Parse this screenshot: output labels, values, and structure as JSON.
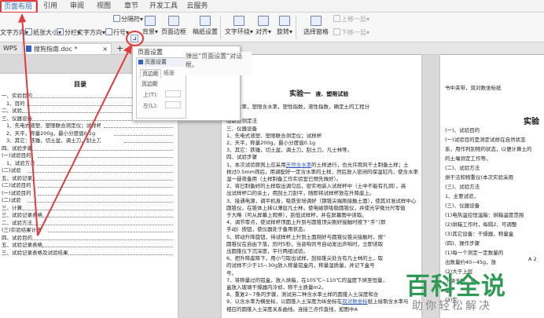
{
  "ribbon": {
    "tabs": [
      "页面布局",
      "引用",
      "审阅",
      "视图",
      "章节",
      "开发工具",
      "云服务"
    ],
    "active_tab": "页面布局"
  },
  "toolbar": {
    "row1": [
      "分隔符",
      "行号",
      "背景",
      "页面边框",
      "稿纸设置",
      "文字环绕",
      "对齐",
      "旋转",
      "选择窗格",
      "上移一层",
      "下移一层"
    ],
    "row2": [
      "文字方向",
      "纸张大小",
      "分栏",
      "文字方向",
      "分隔符"
    ]
  },
  "doc_tabs": {
    "left_label": "WPS",
    "active_doc": "搜狗指南.doc *",
    "add": "+"
  },
  "popup": {
    "title": "页面设置",
    "dialog_title": "页面设置",
    "tabs": [
      "页边距",
      "纸张"
    ],
    "section": "页边距",
    "top_label": "上(T):",
    "left_label": "左(L):",
    "tooltip": "弹出“页面设置”对话框。"
  },
  "page1": {
    "title": "目录",
    "toc": [
      "一、实验目的",
      "1、目的",
      "二、试验",
      "三、仪器设备",
      "1、先电式液塑、塑限联合测定仪；试样杯",
      "2、天平，称量200g，最小分度值0.1g",
      "3、其它：铁锤，切土盆，调土刀，刮土刀，凡士林等。",
      "四、试验步骤",
      "(一)试验目的",
      "1、试验方法",
      "(二)试验",
      "五、试验记录",
      "(二)试验目的",
      "(一)试验目的",
      "(二)试验",
      "三、计算",
      "三、试验记录表格",
      "二、试验方法",
      "(三)实验结果计算",
      "四、试验目的",
      "五、试验记录表格",
      "三、试验记录表格及试验结果"
    ]
  },
  "page2": {
    "heading": "实验一",
    "heading2": "液、塑限试验",
    "lines": [
      "限含水率，塑限含水率，塑性指数，液性指数，确定土的工程分",
      "",
      "限联合测定法",
      "三、仪器设备",
      "1、先电式液塑、塑限联合测定仪；试样杯",
      "2、天平，称量200g，最小分度值0.1g",
      "3、其它：铁锤，切土盆，调土刀，刮土刀，凡士林等。",
      "四、试验步骤",
      "1、本次试验原则上应采用天然含水率的土样进行，也允许用风干土制备土样；土",
      "样过0.5mm筛后，用调配好一定含水率的土样，然后放入密闭的保湿缸内，使含水率",
      "湿一昼夜备用（土样制备工作实验室已预先做好）。",
      "2、将已制备好的土样取出调匀后，密实地装入试样杯中（土中不能有孔洞），高",
      "出试样杯口的余土，用刮土刀刮平，随即将试样杯放在升降座上。",
      "3、接通电源，调平机身，吸铁安培调好（钢锥尖端刚接触土面），使其对准试样中心",
      "圆锥仪，在锥体上抹以薄层凡士林，使电磁铁吸稳圆锥仪，并使光学微分尺零值",
      "于大略（可从屏幕上观察），刮低试样杯，并在屏幕图中读取。",
      "4、调节零点，使试样杯顶面上升到与圆锥顶尖刚好接触时按下“手”（即",
      "手动）按钮，使仪器处于备用状态。",
      "5、转动升降旋钮，待试样杯上升到土面刚好与圆锥仪锥尖接触时，按“",
      "圆锥仪在自由下落，历时5秒，当音响讯号自动发出声响时，立即读取",
      "出圆锥仪下沉深度，平行两组试验。",
      "6、把升降座降下，用小勺取出试样，刮除锥尖处含有凡士林的土，取",
      "的试样不少于15~30g放入称量铝盒内，称量湿质量，并记下盒号",
      "号。",
      "7、将称量过的铝盒，放入烘箱，在105℃~110℃的温度下烘至恒量，",
      "盒放入玻璃干燥器内冷却，称干土质量m2。",
      "8、重复2~7条的步骤，测试另二种含水率土样的圆锥入土深度和含",
      "9、以含水率为横坐标，以圆锥入土深度为纵坐标在双对数坐标纸上绘制含水率与",
      "相应的圆锥入土深度关系曲线。连接三点作直线，如图中A"
    ]
  },
  "page3": {
    "header_line": "书中夹带，双对数坐标纸",
    "heading": "实验",
    "lines": [
      "(一)、试验目的",
      "(一)试验目的是测定试样在自然状态",
      "系，用作判别物的状态，以便计算土的",
      "的土壤测定工作等。",
      "(二)、试验方法",
      "烘干法和物重仪(本次实验采用",
      "(三)、试验方法",
      "1、主要试验，",
      "(三)、仪器设备",
      "(1)电热温控恒温箱：烘箱温度范围",
      "(2)烘箱工作时，每隔2、可调整",
      "(3)其它设备：干燥器，称量盒",
      "(四)、操作步骤",
      "(1)每一个测定一定数量的",
      "出数量约40~45g，放",
      "(2)大于上层",
      "下烘干时，对",
      "量。",
      "(3)实"
    ],
    "figure_label": "A 2"
  },
  "watermark": {
    "main": "百科全说",
    "sub": "助你轻松解决"
  },
  "colors": {
    "accent": "#2f62c2",
    "arrow": "#e33b3b",
    "watermark": "#2f9a54",
    "link": "#2a59c4"
  }
}
